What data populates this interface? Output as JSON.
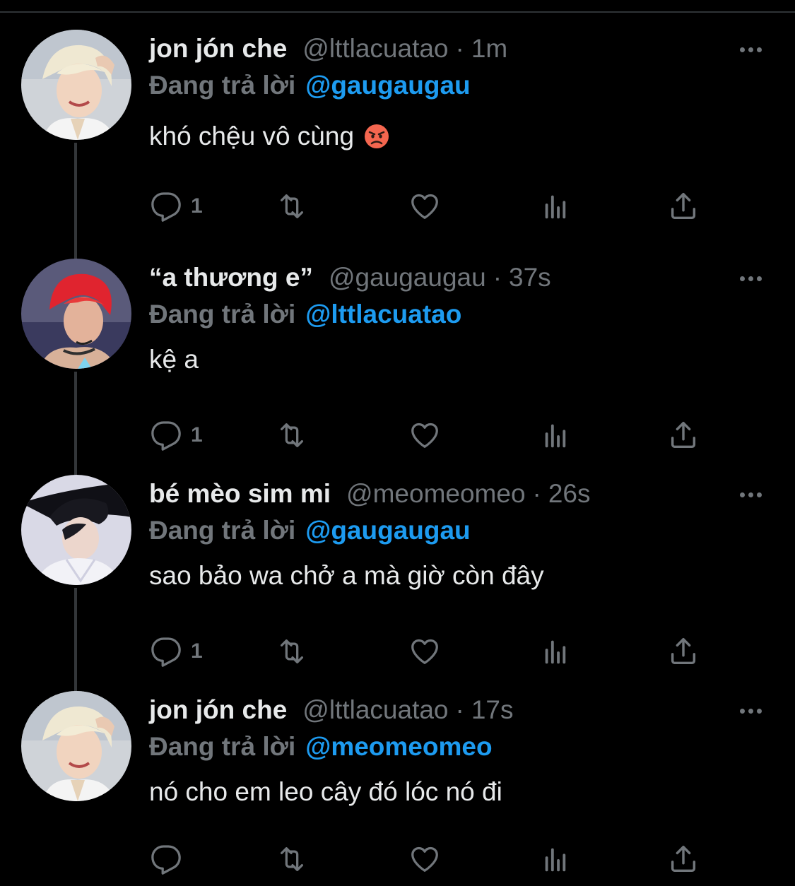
{
  "tweets": [
    {
      "display_name": "jon jón che",
      "handle": "@lttlacuatao",
      "separator": "·",
      "time": "1m",
      "reply_prefix": "Đang trả lời",
      "reply_to": "@gaugaugau",
      "text": "khó chệu vô cùng",
      "emoji": "angry-face",
      "reply_count": "1",
      "avatar_color": "#d9d3c4"
    },
    {
      "display_name": "“a thương e”",
      "handle": "@gaugaugau",
      "separator": "·",
      "time": "37s",
      "reply_prefix": "Đang trả lời",
      "reply_to": "@lttlacuatao",
      "text": "kệ a",
      "reply_count": "1",
      "avatar_color": "#e0242f"
    },
    {
      "display_name": "bé mèo sim mi",
      "handle": "@meomeomeo",
      "separator": "·",
      "time": "26s",
      "reply_prefix": "Đang trả lời",
      "reply_to": "@gaugaugau",
      "text": "sao bảo wa chở a mà giờ còn đây",
      "reply_count": "1",
      "avatar_color": "#1c1c24"
    },
    {
      "display_name": "jon jón che",
      "handle": "@lttlacuatao",
      "separator": "·",
      "time": "17s",
      "reply_prefix": "Đang trả lời",
      "reply_to": "@meomeomeo",
      "text": "nó cho em leo cây đó lóc nó đi",
      "reply_count": "",
      "avatar_color": "#d9d3c4"
    }
  ],
  "icons": {
    "reply": "reply-icon",
    "retweet": "retweet-icon",
    "like": "heart-icon",
    "views": "views-icon",
    "share": "share-icon",
    "more": "more-icon"
  },
  "colors": {
    "background": "#000000",
    "text": "#e7e9ea",
    "muted": "#71767b",
    "accent": "#1d9bf0",
    "thread_line": "#333639"
  }
}
